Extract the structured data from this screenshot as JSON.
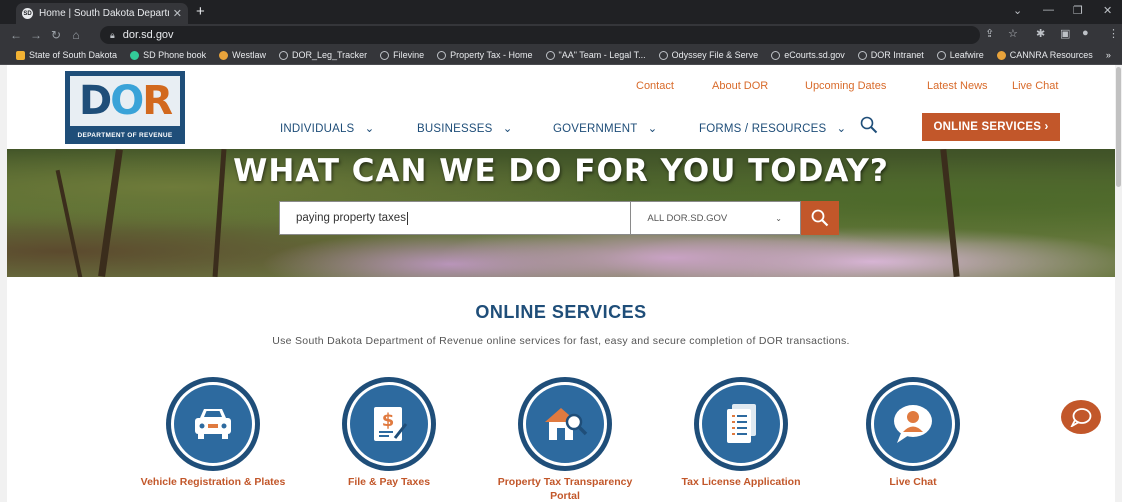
{
  "browser": {
    "tab_title": "Home | South Dakota Departmen",
    "tab_close": "✕",
    "new_tab": "+",
    "url": "dor.sd.gov",
    "bookmarks": [
      "State of South Dakota",
      "SD Phone book",
      "Westlaw",
      "DOR_Leg_Tracker",
      "Filevine",
      "Property Tax - Home",
      "\"AA\" Team - Legal T...",
      "Odyssey File & Serve",
      "eCourts.sd.gov",
      "DOR Intranet",
      "Leafwire",
      "CANNRA Resources"
    ],
    "bookmarks_more": "»"
  },
  "logo": {
    "letters_d": "D",
    "letters_o": "O",
    "letters_r": "R",
    "subtitle": "DEPARTMENT OF REVENUE"
  },
  "top_links": [
    "Contact",
    "About DOR",
    "Upcoming Dates",
    "Latest News",
    "Live Chat"
  ],
  "main_nav": [
    "INDIVIDUALS",
    "BUSINESSES",
    "GOVERNMENT",
    "FORMS / RESOURCES"
  ],
  "nav_chevron": "⌄",
  "online_services_button": "ONLINE SERVICES ›",
  "hero": {
    "heading": "WHAT CAN WE DO FOR YOU TODAY?",
    "search_value": "paying property taxes",
    "scope_selected": "ALL DOR.SD.GOV",
    "scope_chevron": "⌄"
  },
  "online_services": {
    "title": "ONLINE SERVICES",
    "description": "Use South Dakota Department of Revenue online services for fast, easy and secure completion of DOR transactions.",
    "items": [
      {
        "label": "Vehicle Registration & Plates",
        "icon": "car-icon"
      },
      {
        "label": "File & Pay Taxes",
        "icon": "tax-document-icon"
      },
      {
        "label": "Property Tax Transparency Portal",
        "icon": "house-search-icon"
      },
      {
        "label": "Tax License Application",
        "icon": "license-document-icon"
      },
      {
        "label": "Live Chat",
        "icon": "chat-agent-icon"
      }
    ]
  },
  "colors": {
    "brand_blue": "#1f4e79",
    "brand_orange": "#c2572a"
  }
}
